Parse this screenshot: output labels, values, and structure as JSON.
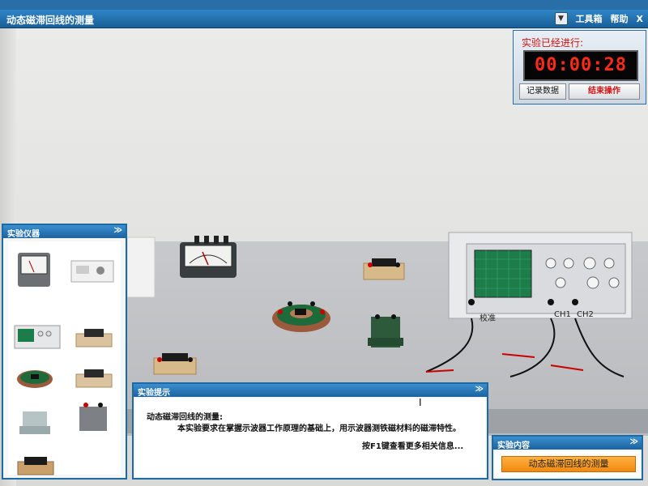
{
  "window": {
    "title": "动态磁滞回线的测量",
    "toolbox": "工具箱",
    "help": "帮助",
    "close": "X",
    "dropdown_icon": "chevron-down-icon"
  },
  "timer": {
    "label": "实验已经进行:",
    "time": "00:00:28",
    "record_button": "记录数据",
    "end_button": "结束操作"
  },
  "instruments_panel": {
    "title": "实验仪器",
    "collapse": "≫",
    "items": [
      "ammeter-icon",
      "power-board-icon",
      "oscilloscope-icon",
      "resistor-box-icon",
      "sample-ring-icon",
      "resistor-box-icon",
      "transformer-icon",
      "battery-icon",
      "resistor-box-icon"
    ]
  },
  "oscilloscope": {
    "labels": [
      "校准",
      "CH1",
      "CH2"
    ]
  },
  "hint_panel": {
    "title": "实验提示",
    "collapse": "≫",
    "line1": "动态磁滞回线的测量:",
    "line2": "本实验要求在掌握示波器工作原理的基础上，用示波器测铁磁材料的磁滞特性。",
    "line3": "按F1键查看更多相关信息..."
  },
  "content_panel": {
    "title": "实验内容",
    "collapse": "≫",
    "item": "动态磁滞回线的测量"
  },
  "colors": {
    "accent": "#1d6aa3",
    "timer_red": "#ff2a1a",
    "content_orange": "#f59a1f"
  }
}
